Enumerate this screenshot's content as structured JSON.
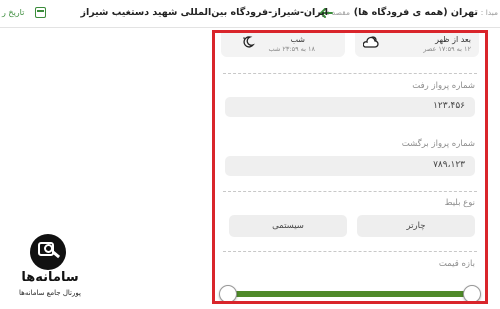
{
  "breadcrumb": {
    "origin_label": "مبدا :",
    "origin_value": "تهران (همه ی فرودگاه ها)",
    "destination_label": "مقصد :",
    "destination_value": "ایران-شیراز-فرودگاه بین‌المللی شهید دستغیب شیراز",
    "date_label": "تاریخ ر"
  },
  "times": {
    "afternoon": {
      "title": "بعد از ظهر",
      "range": "۱۲ به ۱۷:۵۹ عصر"
    },
    "night": {
      "title": "شب",
      "range": "۱۸ به ۲۳:۵۹ شب"
    }
  },
  "fields": {
    "outbound_label": "شماره پرواز رفت",
    "outbound_value": "۱۲۳،۴۵۶",
    "return_label": "شماره پرواز برگشت",
    "return_value": "۷۸۹،۱۲۳"
  },
  "ticket": {
    "label": "نوع بلیط",
    "option_charter": "چارتر",
    "option_system": "سیستمی"
  },
  "price": {
    "label": "بازه قیمت"
  },
  "logo": {
    "name": "سامانه‌ها",
    "tagline": "پورتال جامع سامانه‌ها"
  },
  "colors": {
    "frame": "#d9252b",
    "accent_green": "#4f8a2a"
  }
}
